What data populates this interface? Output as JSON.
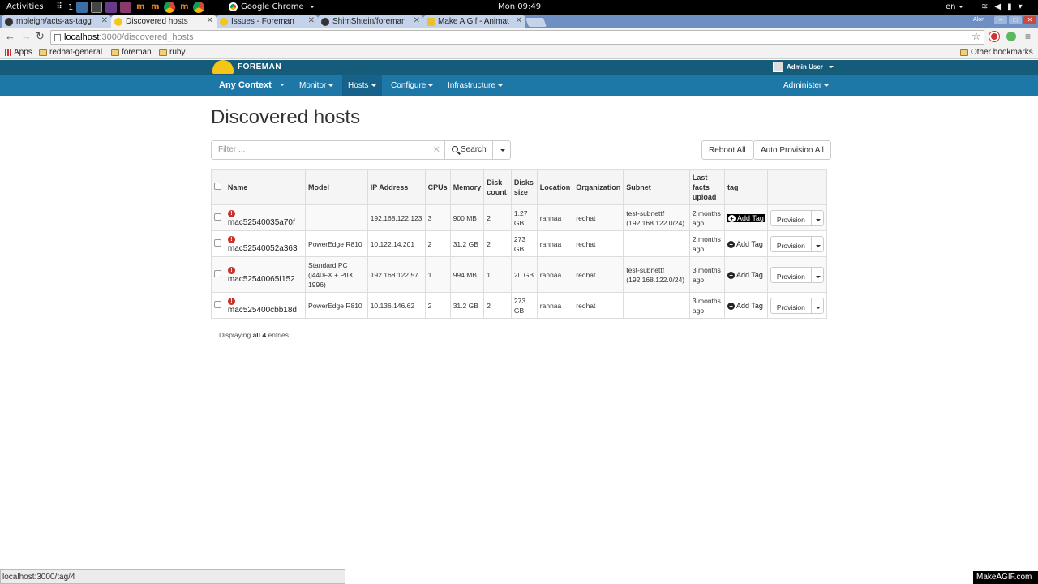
{
  "gnome": {
    "activities": "Activities",
    "workspace": "1",
    "app_name": "Google Chrome",
    "clock": "Mon 09:49",
    "lang": "en"
  },
  "browser": {
    "tabs": [
      {
        "title": "mbleigh/acts-as-tagg",
        "active": false
      },
      {
        "title": "Discovered hosts",
        "active": true
      },
      {
        "title": "Issues - Foreman",
        "active": false
      },
      {
        "title": "ShimShtein/foreman",
        "active": false
      },
      {
        "title": "Make A Gif - Animat",
        "active": false
      }
    ],
    "window_user": "Alon",
    "url_host": "localhost",
    "url_path": ":3000/discovered_hosts",
    "bookmarks": [
      "Apps",
      "redhat-general",
      "foreman",
      "ruby"
    ],
    "other_bookmarks": "Other bookmarks",
    "status_url": "localhost:3000/tag/4"
  },
  "app": {
    "brand": "FOREMAN",
    "user": "Admin User",
    "context": "Any Context",
    "nav": [
      "Monitor",
      "Hosts",
      "Configure",
      "Infrastructure"
    ],
    "active_nav": "Hosts",
    "administer": "Administer",
    "brand_color": "#1d78a8"
  },
  "page": {
    "title": "Discovered hosts",
    "filter_placeholder": "Filter ...",
    "search_label": "Search",
    "reboot_all": "Reboot All",
    "auto_provision_all": "Auto Provision All",
    "columns": [
      "Name",
      "Model",
      "IP Address",
      "CPUs",
      "Memory",
      "Disk count",
      "Disks size",
      "Location",
      "Organization",
      "Subnet",
      "Last facts upload",
      "tag"
    ],
    "rows": [
      {
        "name": "mac52540035a70f",
        "model": "",
        "ip": "192.168.122.123",
        "cpus": "3",
        "memory": "900 MB",
        "disk_count": "2",
        "disks_size": "1.27 GB",
        "location": "rannaa",
        "organization": "redhat",
        "subnet": "test-subnettf (192.168.122.0/24)",
        "last_facts": "2 months ago",
        "tag": "Add Tag",
        "action": "Provision"
      },
      {
        "name": "mac52540052a363",
        "model": "PowerEdge R810",
        "ip": "10.122.14.201",
        "cpus": "2",
        "memory": "31.2 GB",
        "disk_count": "2",
        "disks_size": "273 GB",
        "location": "rannaa",
        "organization": "redhat",
        "subnet": "",
        "last_facts": "2 months ago",
        "tag": "Add Tag",
        "action": "Provision"
      },
      {
        "name": "mac52540065f152",
        "model": "Standard PC (i440FX + PIIX, 1996)",
        "ip": "192.168.122.57",
        "cpus": "1",
        "memory": "994 MB",
        "disk_count": "1",
        "disks_size": "20 GB",
        "location": "rannaa",
        "organization": "redhat",
        "subnet": "test-subnettf (192.168.122.0/24)",
        "last_facts": "3 months ago",
        "tag": "Add Tag",
        "action": "Provision"
      },
      {
        "name": "mac525400cbb18d",
        "model": "PowerEdge R810",
        "ip": "10.136.146.62",
        "cpus": "2",
        "memory": "31.2 GB",
        "disk_count": "2",
        "disks_size": "273 GB",
        "location": "rannaa",
        "organization": "redhat",
        "subnet": "",
        "last_facts": "3 months ago",
        "tag": "Add Tag",
        "action": "Provision"
      }
    ],
    "displaying_prefix": "Displaying ",
    "displaying_bold": "all 4",
    "displaying_suffix": " entries"
  },
  "watermark": "MakeAGIF.com"
}
